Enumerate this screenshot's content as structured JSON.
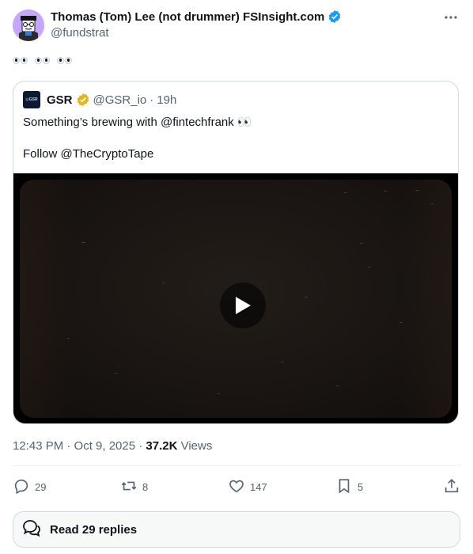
{
  "author": {
    "name": "Thomas (Tom) Lee (not drummer) FSInsight.com",
    "handle": "@fundstrat"
  },
  "tweet": {
    "text_emoji": "eyes x3"
  },
  "quoted": {
    "name": "GSR",
    "handle": "@GSR_io",
    "separator": "·",
    "time": "19h",
    "avatar_text": "◎GSR",
    "line1": "Something’s brewing with @fintechfrank 👀",
    "line2": "Follow @TheCryptoTape"
  },
  "meta": {
    "time": "12:43 PM · Oct 9, 2025 · ",
    "views_count": "37.2K",
    "views_label": " Views"
  },
  "actions": {
    "replies": "29",
    "reposts": "8",
    "likes": "147",
    "bookmarks": "5"
  },
  "read_replies": {
    "label": "Read 29 replies"
  },
  "colors": {
    "verified_blue": "#1d9bf0",
    "verified_gold": "#e2b719",
    "muted": "#536471"
  }
}
